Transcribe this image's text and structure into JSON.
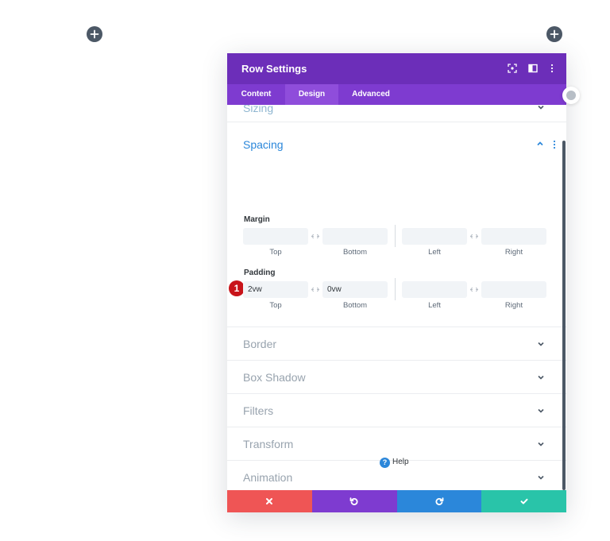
{
  "canvas": {
    "add_row_symbol": "+"
  },
  "modal": {
    "title": "Row Settings",
    "header_icons": [
      "expand-icon",
      "sidebar-icon",
      "more-icon"
    ],
    "tabs": [
      {
        "label": "Content",
        "active": false
      },
      {
        "label": "Design",
        "active": true
      },
      {
        "label": "Advanced",
        "active": false
      }
    ],
    "sections_above": [
      "Sizing"
    ],
    "spacing": {
      "title": "Spacing",
      "expanded": true,
      "margin": {
        "label": "Margin",
        "fields": [
          {
            "label": "Top",
            "value": ""
          },
          {
            "label": "Bottom",
            "value": ""
          },
          {
            "label": "Left",
            "value": ""
          },
          {
            "label": "Right",
            "value": ""
          }
        ]
      },
      "padding": {
        "label": "Padding",
        "fields": [
          {
            "label": "Top",
            "value": "2vw"
          },
          {
            "label": "Bottom",
            "value": "0vw"
          },
          {
            "label": "Left",
            "value": ""
          },
          {
            "label": "Right",
            "value": ""
          }
        ]
      },
      "step_badge": "1"
    },
    "sections": [
      {
        "label": "Border"
      },
      {
        "label": "Box Shadow"
      },
      {
        "label": "Filters"
      },
      {
        "label": "Transform"
      },
      {
        "label": "Animation"
      }
    ],
    "help_label": "Help",
    "footer": {
      "buttons": [
        {
          "name": "discard",
          "color": "#ef5555"
        },
        {
          "name": "undo",
          "color": "#7e3bd0"
        },
        {
          "name": "redo",
          "color": "#2b87da"
        },
        {
          "name": "save",
          "color": "#29c4a9"
        }
      ]
    },
    "colors": {
      "header": "#6c2eb9",
      "tabs": "#7e3bd0",
      "accent": "#2b87da",
      "badge": "#c8141a"
    }
  }
}
